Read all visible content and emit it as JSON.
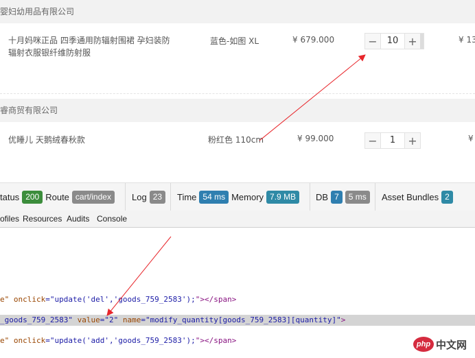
{
  "shops": [
    {
      "name": "婴妇幼用品有限公司",
      "items": [
        {
          "title_line1": "十月妈咪正品 四季通用防辐射围裙 孕妇装防",
          "title_line2": "辐射衣服银纤维防射服",
          "spec": "蓝色-如图 XL",
          "price": "¥ 679.000",
          "quantity": "10",
          "subtotal": "¥ 13"
        }
      ]
    },
    {
      "name": "睿商贸有限公司",
      "items": [
        {
          "title_line1": "优睡儿 天鹅绒春秋款",
          "spec": "粉红色 110cm",
          "price": "¥ 99.000",
          "quantity": "1",
          "subtotal": "¥"
        }
      ]
    }
  ],
  "stepper": {
    "minus": "−",
    "plus": "+"
  },
  "debug_toolbar": {
    "status_label": "tatus",
    "status_value": "200",
    "route_label": "Route",
    "route_value": "cart/index",
    "log_label": "Log",
    "log_value": "23",
    "time_label": "Time",
    "time_value": "54 ms",
    "memory_label": "Memory",
    "memory_value": "7.9 MB",
    "db_label": "DB",
    "db_count": "7",
    "db_time": "5 ms",
    "assets_label": "Asset Bundles",
    "assets_value": "2"
  },
  "devtools_tabs": [
    "ofiles",
    "Resources",
    "Audits",
    "Console"
  ],
  "code": {
    "line1": {
      "a": "e\" ",
      "attr": "onclick",
      "eq": "=\"",
      "val": "update('del','goods_759_2583');",
      "end": "\"></span>"
    },
    "line2": {
      "a": "_goods_759_2583\" ",
      "attr1": "value",
      "val1": "=\"2\" ",
      "attr2": "name",
      "val2": "=\"modify_quantity[goods_759_2583][quantity]\"",
      "end": ">"
    },
    "line3": {
      "a": "e\" ",
      "attr": "onclick",
      "eq": "=\"",
      "val": "update('add','goods_759_2583');",
      "end": "\"></span>"
    }
  },
  "logo": {
    "mark": "php",
    "text": "中文网"
  },
  "colors": {
    "green": "#3c8d3c",
    "gray": "#8a8a8a",
    "blue": "#2f7fb0",
    "teal": "#2f8aa6",
    "arrow": "#e8262b"
  }
}
